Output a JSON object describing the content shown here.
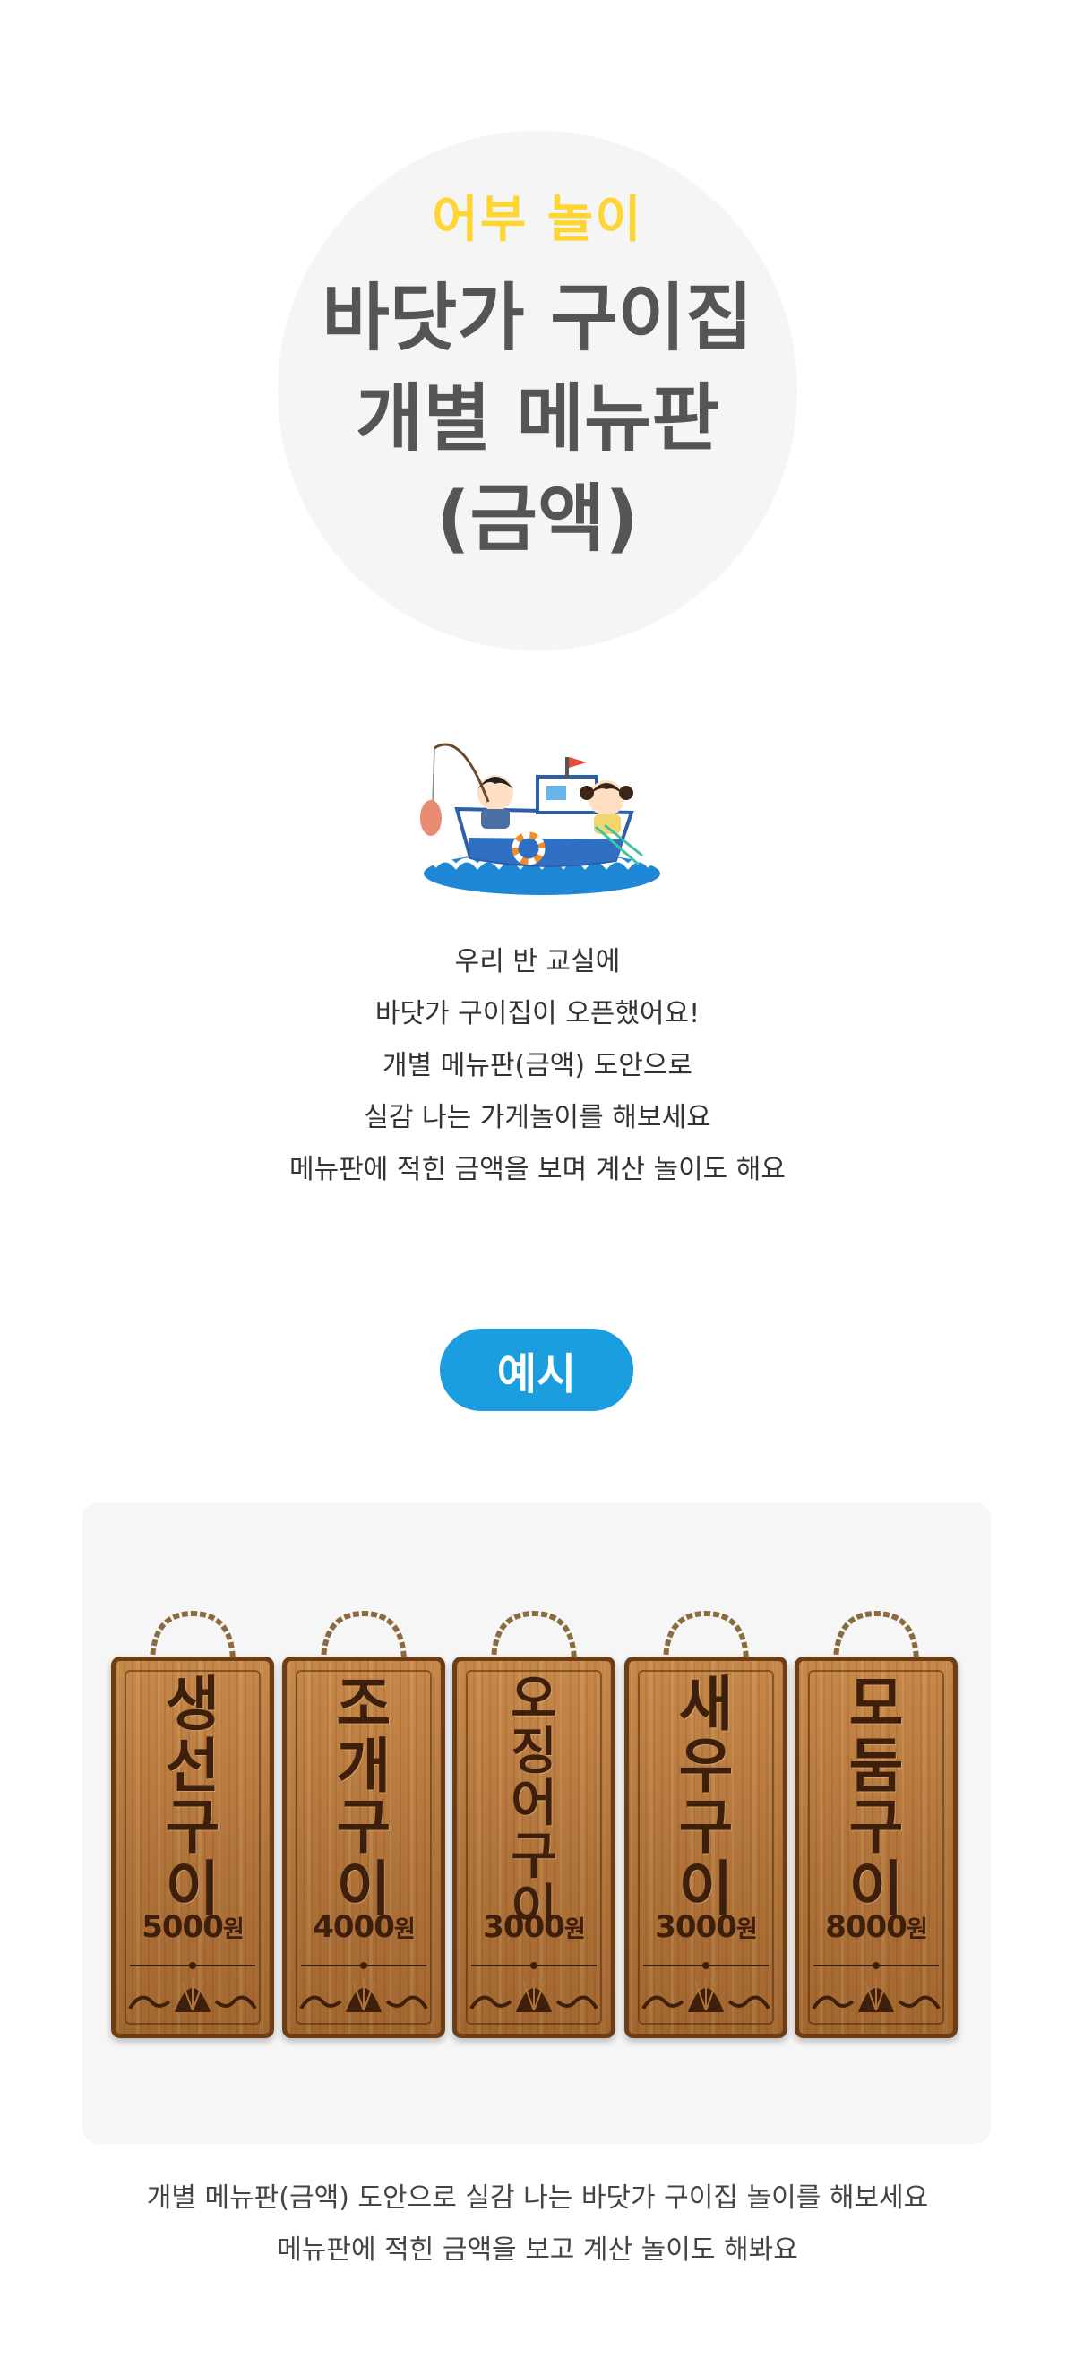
{
  "hero": {
    "subtitle": "어부 놀이",
    "title_lines": [
      "바닷가 구이집",
      "개별 메뉴판",
      "(금액)"
    ]
  },
  "illustration": {
    "icon": "fishing-boat-kids-illustration"
  },
  "intro": {
    "lines": [
      "우리 반 교실에",
      "바닷가 구이집이 오픈했어요!",
      "개별 메뉴판(금액) 도안으로",
      "실감 나는 가게놀이를 해보세요",
      "메뉴판에 적힌 금액을 보며 계산 놀이도 해요"
    ]
  },
  "example": {
    "label": "예시"
  },
  "menu_boards": [
    {
      "name_chars": [
        "생",
        "선",
        "구",
        "이"
      ],
      "amount": "5000",
      "unit": "원"
    },
    {
      "name_chars": [
        "조",
        "개",
        "구",
        "이"
      ],
      "amount": "4000",
      "unit": "원"
    },
    {
      "name_chars": [
        "오",
        "징",
        "어",
        "구",
        "이"
      ],
      "amount": "3000",
      "unit": "원"
    },
    {
      "name_chars": [
        "새",
        "우",
        "구",
        "이"
      ],
      "amount": "3000",
      "unit": "원"
    },
    {
      "name_chars": [
        "모",
        "둠",
        "구",
        "이"
      ],
      "amount": "8000",
      "unit": "원"
    }
  ],
  "caption": {
    "lines": [
      "개별 메뉴판(금액) 도안으로 실감 나는 바닷가 구이집 놀이를 해보세요",
      "메뉴판에 적힌 금액을 보고 계산 놀이도 해봐요"
    ]
  },
  "colors": {
    "subtitle": "#ffd531",
    "title": "#555555",
    "pill": "#1a9ee0",
    "wood": "#b0733a",
    "wood_text": "#3e1f0b",
    "panel": "#f6f6f6"
  }
}
